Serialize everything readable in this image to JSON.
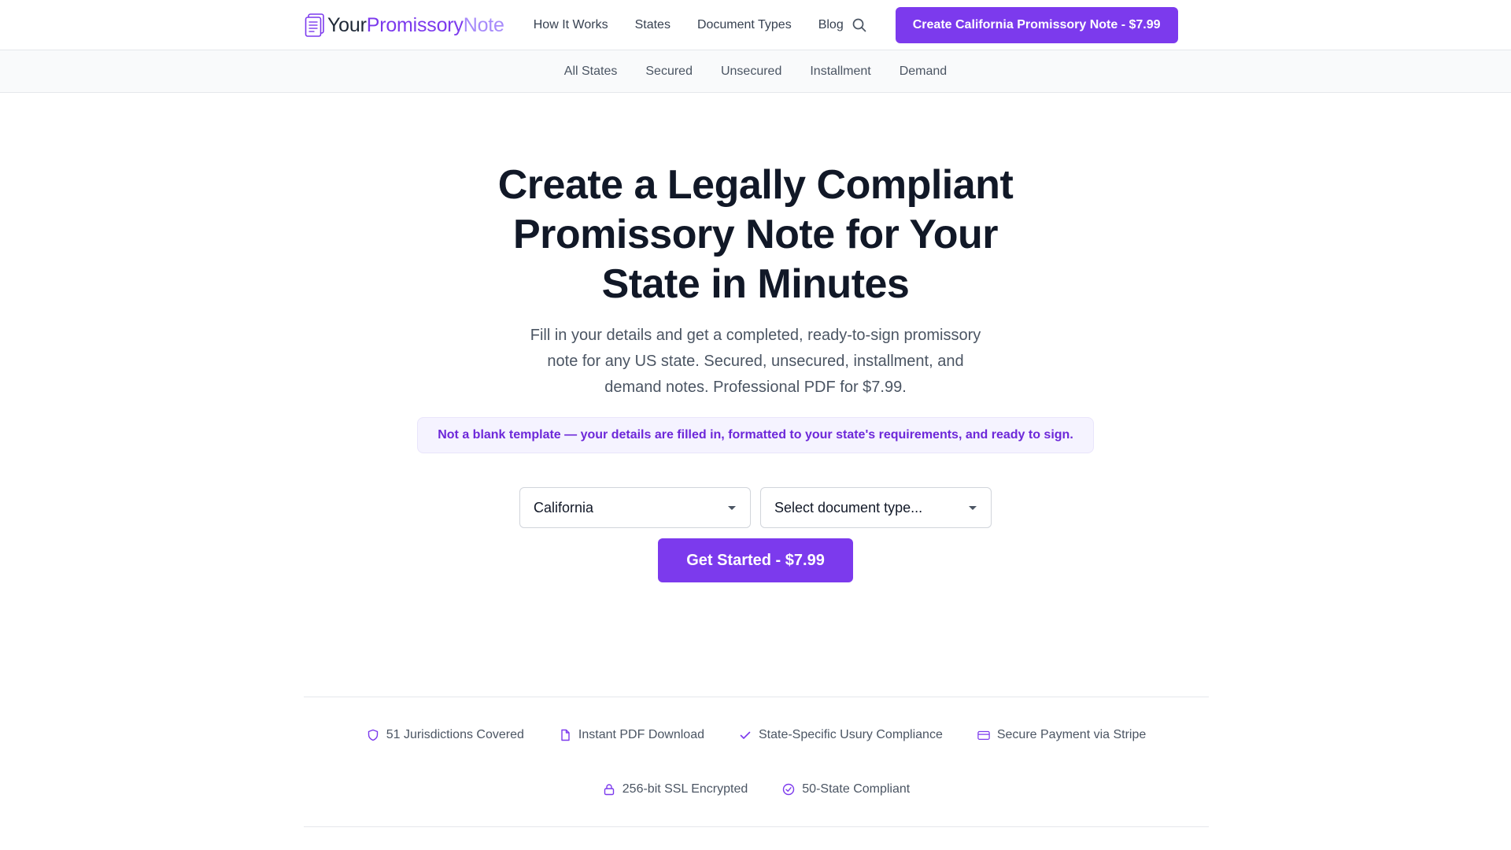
{
  "header": {
    "logo": {
      "part1": "Your",
      "part2": "Promissory",
      "part3": "Note"
    },
    "nav": [
      "How It Works",
      "States",
      "Document Types",
      "Blog"
    ],
    "search_icon": "search-icon",
    "cta_label": "Create California Promissory Note - $7.99"
  },
  "subnav": [
    "All States",
    "Secured",
    "Unsecured",
    "Installment",
    "Demand"
  ],
  "hero": {
    "title_line1": "Create a Legally Compliant",
    "title_line2": "Promissory Note for Your",
    "title_line3": "State in Minutes",
    "subtitle": "Fill in your details and get a completed, ready-to-sign promissory note for any US state. Secured, unsecured, installment, and demand notes. Professional PDF for $7.99.",
    "notice": "Not a blank template — your details are filled in, formatted to your state's requirements, and ready to sign."
  },
  "form": {
    "state_value": "California",
    "doc_type_placeholder": "Select document type...",
    "submit_label": "Get Started - $7.99"
  },
  "trust": {
    "row1": [
      {
        "icon": "shield-icon",
        "label": "51 Jurisdictions Covered"
      },
      {
        "icon": "file-icon",
        "label": "Instant PDF Download"
      },
      {
        "icon": "check-icon",
        "label": "State-Specific Usury Compliance"
      },
      {
        "icon": "credit-card-icon",
        "label": "Secure Payment via Stripe"
      }
    ],
    "row2": [
      {
        "icon": "lock-icon",
        "label": "256-bit SSL Encrypted"
      },
      {
        "icon": "check-circle-icon",
        "label": "50-State Compliant"
      }
    ]
  },
  "colors": {
    "brand": "#7c3aed",
    "brand_light": "#f5f3ff",
    "text_dark": "#111827",
    "text_muted": "#4b5563",
    "border": "#e5e7eb"
  }
}
